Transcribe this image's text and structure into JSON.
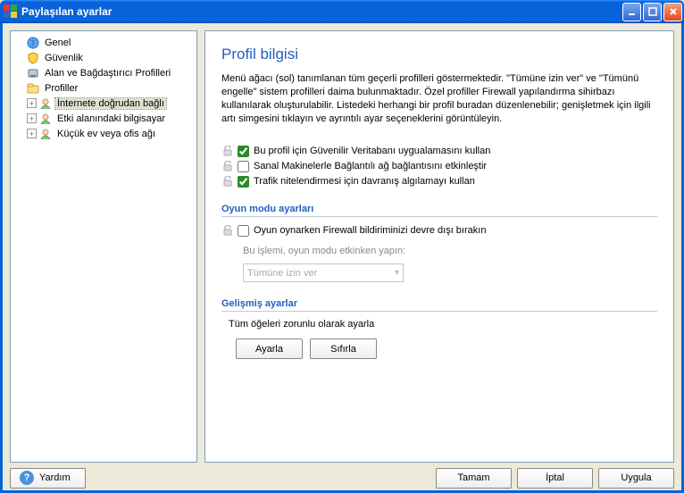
{
  "window": {
    "title": "Paylaşılan ayarlar"
  },
  "tree": {
    "items": [
      {
        "label": "Genel",
        "icon": "globe",
        "expand": ""
      },
      {
        "label": "Güvenlik",
        "icon": "shield",
        "expand": ""
      },
      {
        "label": "Alan ve Bağdaştırıcı Profilleri",
        "icon": "nic",
        "expand": ""
      },
      {
        "label": "Profiller",
        "icon": "folder",
        "expand": ""
      },
      {
        "label": "İnternete doğrudan bağlı",
        "icon": "user",
        "expand": "+",
        "indent": 1,
        "selected": true
      },
      {
        "label": "Etki alanındaki bilgisayar",
        "icon": "user",
        "expand": "+",
        "indent": 1
      },
      {
        "label": "Küçük ev veya ofis ağı",
        "icon": "user",
        "expand": "+",
        "indent": 1
      }
    ]
  },
  "content": {
    "title": "Profil bilgisi",
    "description": "Menü ağacı (sol) tanımlanan tüm geçerli profilleri göstermektedir. \"Tümüne izin ver\" ve \"Tümünü engelle\" sistem profilleri daima bulunmaktadır. Özel profiller Firewall yapılandırma sihirbazı kullanılarak oluşturulabilir. Listedeki herhangi bir profil buradan düzenlenebilir; genişletmek için ilgili artı simgesini tıklayın ve ayrıntılı ayar seçeneklerini görüntüleyin.",
    "checks": [
      {
        "label": "Bu profil için Güvenilir Veritabanı uygualamasını kullan",
        "checked": true
      },
      {
        "label": "Sanal Makinelerle Bağlantılı ağ bağlantısını etkinleştir",
        "checked": false
      },
      {
        "label": "Trafik nitelendirmesi için davranış algılamayı kullan",
        "checked": true
      }
    ],
    "game": {
      "heading": "Oyun modu ayarları",
      "check_label": "Oyun oynarken Firewall bildiriminizi devre dışı bırakın",
      "sub_text": "Bu işlemi, oyun modu etkinken yapın:",
      "select_value": "Tümüne izin ver"
    },
    "advanced": {
      "heading": "Gelişmiş ayarlar",
      "desc": "Tüm öğeleri zorunlu olarak ayarla",
      "set_btn": "Ayarla",
      "reset_btn": "Sıfırla"
    }
  },
  "footer": {
    "help": "Yardım",
    "ok": "Tamam",
    "cancel": "İptal",
    "apply": "Uygula"
  }
}
